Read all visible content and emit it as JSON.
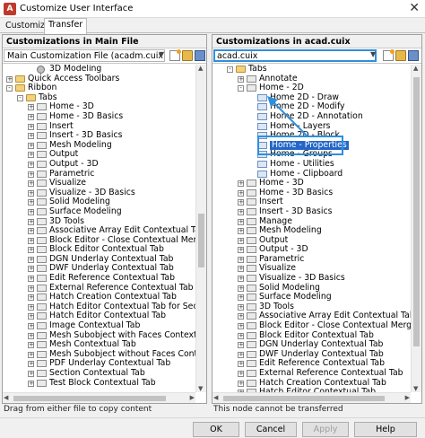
{
  "window": {
    "title": "Customize User Interface",
    "app_icon": "autocad-icon",
    "close_glyph": "✕"
  },
  "tabs": [
    {
      "label": "Customize"
    },
    {
      "label": "Transfer"
    }
  ],
  "left": {
    "title": "Customizations in Main File",
    "combo_value": "Main Customization File (acadm.cuix)",
    "items": [
      {
        "label": "3D Modeling",
        "level": 2,
        "icon": "gear",
        "expander": ""
      },
      {
        "label": "Quick Access Toolbars",
        "level": 0,
        "icon": "folder",
        "expander": "+"
      },
      {
        "label": "Ribbon",
        "level": 0,
        "icon": "folder",
        "expander": "-"
      },
      {
        "label": "Tabs",
        "level": 1,
        "icon": "folder",
        "expander": "-"
      },
      {
        "label": "Home - 3D",
        "level": 2,
        "icon": "tab",
        "expander": "+"
      },
      {
        "label": "Home - 3D Basics",
        "level": 2,
        "icon": "tab",
        "expander": "+"
      },
      {
        "label": "Insert",
        "level": 2,
        "icon": "tab",
        "expander": "+"
      },
      {
        "label": "Insert - 3D Basics",
        "level": 2,
        "icon": "tab",
        "expander": "+"
      },
      {
        "label": "Mesh Modeling",
        "level": 2,
        "icon": "tab",
        "expander": "+"
      },
      {
        "label": "Output",
        "level": 2,
        "icon": "tab",
        "expander": "+"
      },
      {
        "label": "Output - 3D",
        "level": 2,
        "icon": "tab",
        "expander": "+"
      },
      {
        "label": "Parametric",
        "level": 2,
        "icon": "tab",
        "expander": "+"
      },
      {
        "label": "Visualize",
        "level": 2,
        "icon": "tab",
        "expander": "+"
      },
      {
        "label": "Visualize - 3D Basics",
        "level": 2,
        "icon": "tab",
        "expander": "+"
      },
      {
        "label": "Solid Modeling",
        "level": 2,
        "icon": "tab",
        "expander": "+"
      },
      {
        "label": "Surface Modeling",
        "level": 2,
        "icon": "tab",
        "expander": "+"
      },
      {
        "label": "3D Tools",
        "level": 2,
        "icon": "tab",
        "expander": "+"
      },
      {
        "label": "Associative Array Edit Contextual Tab",
        "level": 2,
        "icon": "tab",
        "expander": "+"
      },
      {
        "label": "Block Editor - Close Contextual Merged Ta",
        "level": 2,
        "icon": "tab",
        "expander": "+"
      },
      {
        "label": "Block Editor Contextual Tab",
        "level": 2,
        "icon": "tab",
        "expander": "+"
      },
      {
        "label": "DGN Underlay Contextual Tab",
        "level": 2,
        "icon": "tab",
        "expander": "+"
      },
      {
        "label": "DWF Underlay Contextual Tab",
        "level": 2,
        "icon": "tab",
        "expander": "+"
      },
      {
        "label": "Edit Reference Contextual Tab",
        "level": 2,
        "icon": "tab",
        "expander": "+"
      },
      {
        "label": "External Reference Contextual Tab",
        "level": 2,
        "icon": "tab",
        "expander": "+"
      },
      {
        "label": "Hatch Creation Contextual Tab",
        "level": 2,
        "icon": "tab",
        "expander": "+"
      },
      {
        "label": "Hatch Editor Contextual Tab for Section Vie",
        "level": 2,
        "icon": "tab",
        "expander": "+"
      },
      {
        "label": "Hatch Editor Contextual Tab",
        "level": 2,
        "icon": "tab",
        "expander": "+"
      },
      {
        "label": "Image Contextual Tab",
        "level": 2,
        "icon": "tab",
        "expander": "+"
      },
      {
        "label": "Mesh Subobject with Faces Contextual Tab",
        "level": 2,
        "icon": "tab",
        "expander": "+"
      },
      {
        "label": "Mesh Contextual Tab",
        "level": 2,
        "icon": "tab",
        "expander": "+"
      },
      {
        "label": "Mesh Subobject without Faces Contextual",
        "level": 2,
        "icon": "tab",
        "expander": "+"
      },
      {
        "label": "PDF Underlay Contextual Tab",
        "level": 2,
        "icon": "tab",
        "expander": "+"
      },
      {
        "label": "Section Contextual Tab",
        "level": 2,
        "icon": "tab",
        "expander": "+"
      },
      {
        "label": "Test Block Contextual Tab",
        "level": 2,
        "icon": "tab",
        "expander": "+"
      }
    ]
  },
  "right": {
    "title": "Customizations in acad.cuix",
    "combo_value": "acad.cuix",
    "items": [
      {
        "label": "Tabs",
        "level": 1,
        "icon": "folder",
        "expander": "-"
      },
      {
        "label": "Annotate",
        "level": 2,
        "icon": "tab",
        "expander": "+"
      },
      {
        "label": "Home - 2D",
        "level": 2,
        "icon": "tab",
        "expander": "-"
      },
      {
        "label": "Home 2D - Draw",
        "level": 3,
        "icon": "panel",
        "expander": ""
      },
      {
        "label": "Home 2D - Modify",
        "level": 3,
        "icon": "panel",
        "expander": ""
      },
      {
        "label": "Home 2D - Annotation",
        "level": 3,
        "icon": "panel",
        "expander": ""
      },
      {
        "label": "Home - Layers",
        "level": 3,
        "icon": "panel",
        "expander": ""
      },
      {
        "label": "Home 2D - Block",
        "level": 3,
        "icon": "panel",
        "expander": ""
      },
      {
        "label": "Home - Properties",
        "level": 3,
        "icon": "panel",
        "expander": "",
        "selected": true
      },
      {
        "label": "Home - Groups",
        "level": 3,
        "icon": "panel",
        "expander": ""
      },
      {
        "label": "Home - Utilities",
        "level": 3,
        "icon": "panel",
        "expander": ""
      },
      {
        "label": "Home - Clipboard",
        "level": 3,
        "icon": "panel",
        "expander": ""
      },
      {
        "label": "Home - 3D",
        "level": 2,
        "icon": "tab",
        "expander": "+"
      },
      {
        "label": "Home - 3D Basics",
        "level": 2,
        "icon": "tab",
        "expander": "+"
      },
      {
        "label": "Insert",
        "level": 2,
        "icon": "tab",
        "expander": "+"
      },
      {
        "label": "Insert - 3D Basics",
        "level": 2,
        "icon": "tab",
        "expander": "+"
      },
      {
        "label": "Manage",
        "level": 2,
        "icon": "tab",
        "expander": "+"
      },
      {
        "label": "Mesh Modeling",
        "level": 2,
        "icon": "tab",
        "expander": "+"
      },
      {
        "label": "Output",
        "level": 2,
        "icon": "tab",
        "expander": "+"
      },
      {
        "label": "Output - 3D",
        "level": 2,
        "icon": "tab",
        "expander": "+"
      },
      {
        "label": "Parametric",
        "level": 2,
        "icon": "tab",
        "expander": "+"
      },
      {
        "label": "Visualize",
        "level": 2,
        "icon": "tab",
        "expander": "+"
      },
      {
        "label": "Visualize - 3D Basics",
        "level": 2,
        "icon": "tab",
        "expander": "+"
      },
      {
        "label": "Solid Modeling",
        "level": 2,
        "icon": "tab",
        "expander": "+"
      },
      {
        "label": "Surface Modeling",
        "level": 2,
        "icon": "tab",
        "expander": "+"
      },
      {
        "label": "3D Tools",
        "level": 2,
        "icon": "tab",
        "expander": "+"
      },
      {
        "label": "Associative Array Edit Contextual Tab",
        "level": 2,
        "icon": "tab",
        "expander": "+"
      },
      {
        "label": "Block Editor - Close Contextual Merged Tab",
        "level": 2,
        "icon": "tab",
        "expander": "+"
      },
      {
        "label": "Block Editor Contextual Tab",
        "level": 2,
        "icon": "tab",
        "expander": "+"
      },
      {
        "label": "DGN Underlay Contextual Tab",
        "level": 2,
        "icon": "tab",
        "expander": "+"
      },
      {
        "label": "DWF Underlay Contextual Tab",
        "level": 2,
        "icon": "tab",
        "expander": "+"
      },
      {
        "label": "Edit Reference Contextual Tab",
        "level": 2,
        "icon": "tab",
        "expander": "+"
      },
      {
        "label": "External Reference Contextual Tab",
        "level": 2,
        "icon": "tab",
        "expander": "+"
      },
      {
        "label": "Hatch Creation Contextual Tab",
        "level": 2,
        "icon": "tab",
        "expander": "+"
      },
      {
        "label": "Hatch Editor Contextual Tab",
        "level": 2,
        "icon": "tab",
        "expander": "+"
      }
    ]
  },
  "status": {
    "left": "Drag from either file to copy content",
    "right": "This node cannot be transferred"
  },
  "buttons": {
    "ok": "OK",
    "cancel": "Cancel",
    "apply": "Apply",
    "help": "Help"
  },
  "colors": {
    "selection": "#2466c8",
    "annotation": "#2f8fdd"
  }
}
